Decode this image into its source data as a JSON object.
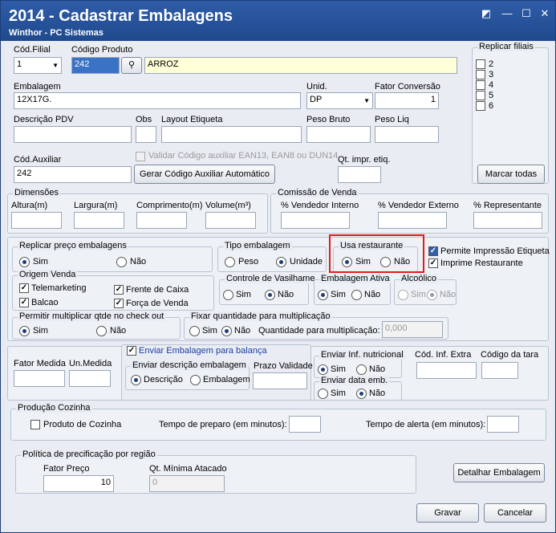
{
  "window": {
    "title": "2014 - Cadastrar Embalagens",
    "subtitle": "Winthor - PC Sistemas",
    "btn_restore": "◩",
    "btn_minimize": "—",
    "btn_maximize": "☐",
    "btn_close": "✕"
  },
  "top": {
    "cod_filial_label": "Cód.Filial",
    "cod_filial_value": "1",
    "codigo_produto_label": "Código Produto",
    "codigo_produto_value": "242",
    "produto_nome": "ARROZ",
    "embalagem_label": "Embalagem",
    "embalagem_value": "12X17G.",
    "unid_label": "Unid.",
    "unid_value": "DP",
    "fator_conversao_label": "Fator Conversão",
    "fator_conversao_value": "1",
    "descricao_pdv_label": "Descrição PDV",
    "obs_label": "Obs",
    "layout_etiqueta_label": "Layout Etiqueta",
    "peso_bruto_label": "Peso Bruto",
    "peso_liq_label": "Peso Liq",
    "cod_auxiliar_label": "Cód.Auxiliar",
    "cod_auxiliar_value": "242",
    "validar_label": "Validar Código auxiliar EAN13, EAN8 ou DUN14",
    "gerar_button": "Gerar Código Auxiliar Automático",
    "qt_impr_label": "Qt. impr. etiq."
  },
  "replicar_filiais": {
    "title": "Replicar filiais",
    "items": [
      "2",
      "3",
      "4",
      "5",
      "6"
    ],
    "marcar_todas": "Marcar todas"
  },
  "dimensoes": {
    "title": "Dimensões",
    "altura": "Altura(m)",
    "largura": "Largura(m)",
    "comprimento": "Comprimento(m)",
    "volume": "Volume(m³)"
  },
  "comissao": {
    "title": "Comissão de Venda",
    "interno": "% Vendedor Interno",
    "externo": "% Vendedor Externo",
    "representante": "% Representante"
  },
  "replicar_preco": {
    "title": "Replicar preço embalagens",
    "sim": "Sim",
    "nao": "Não"
  },
  "tipo_embalagem": {
    "title": "Tipo embalagem",
    "peso": "Peso",
    "unidade": "Unidade"
  },
  "usa_restaurante": {
    "title": "Usa restaurante",
    "sim": "Sim",
    "nao": "Não"
  },
  "permite_impressao": "Permite Impressão Etiqueta",
  "imprime_restaurante": "Imprime Restaurante",
  "origem_venda": {
    "title": "Origem Venda",
    "telemarketing": "Telemarketing",
    "balcao": "Balcao",
    "frente_caixa": "Frente de Caixa",
    "forca_venda": "Força de Venda"
  },
  "controle_vasilhame": {
    "title": "Controle de Vasilhame",
    "sim": "Sim",
    "nao": "Não"
  },
  "embalagem_ativa": {
    "title": "Embalagem Ativa",
    "sim": "Sim",
    "nao": "Não"
  },
  "alcoolico": {
    "title": "Alcoólico",
    "sim": "Sim",
    "nao": "Não"
  },
  "multiplicar": {
    "title": "Permitir multiplicar qtde no check out",
    "sim": "Sim",
    "nao": "Não"
  },
  "fixar_qtd": {
    "title": "Fixar quantidade para multiplicação",
    "sim": "Sim",
    "nao": "Não",
    "qtd_label": "Quantidade para multiplicação:",
    "qtd_value": "0,000"
  },
  "fator_medida": "Fator Medida",
  "un_medida": "Un.Medida",
  "balanca": {
    "enviar_label": "Enviar Embalagem para balança",
    "descricao_title": "Enviar descrição embalagem",
    "descricao": "Descrição",
    "embalagem": "Embalagem",
    "prazo": "Prazo Validade",
    "inf_nutri_title": "Enviar Inf. nutricional",
    "sim": "Sim",
    "nao": "Não",
    "data_emb_title": "Enviar data emb.",
    "cod_inf_extra": "Cód. Inf. Extra",
    "codigo_tara": "Código da tara"
  },
  "producao": {
    "title": "Produção Cozinha",
    "produto_cozinha": "Produto de Cozinha",
    "tempo_preparo": "Tempo de preparo (em minutos):",
    "tempo_alerta": "Tempo de alerta (em minutos):"
  },
  "politica": {
    "title": "Política de precificação por região",
    "fator_preco_label": "Fator Preço",
    "fator_preco_value": "10",
    "qt_minima_label": "Qt. Mínima Atacado",
    "qt_minima_value": "0"
  },
  "detalhar_button": "Detalhar Embalagem",
  "gravar_button": "Gravar",
  "cancelar_button": "Cancelar"
}
